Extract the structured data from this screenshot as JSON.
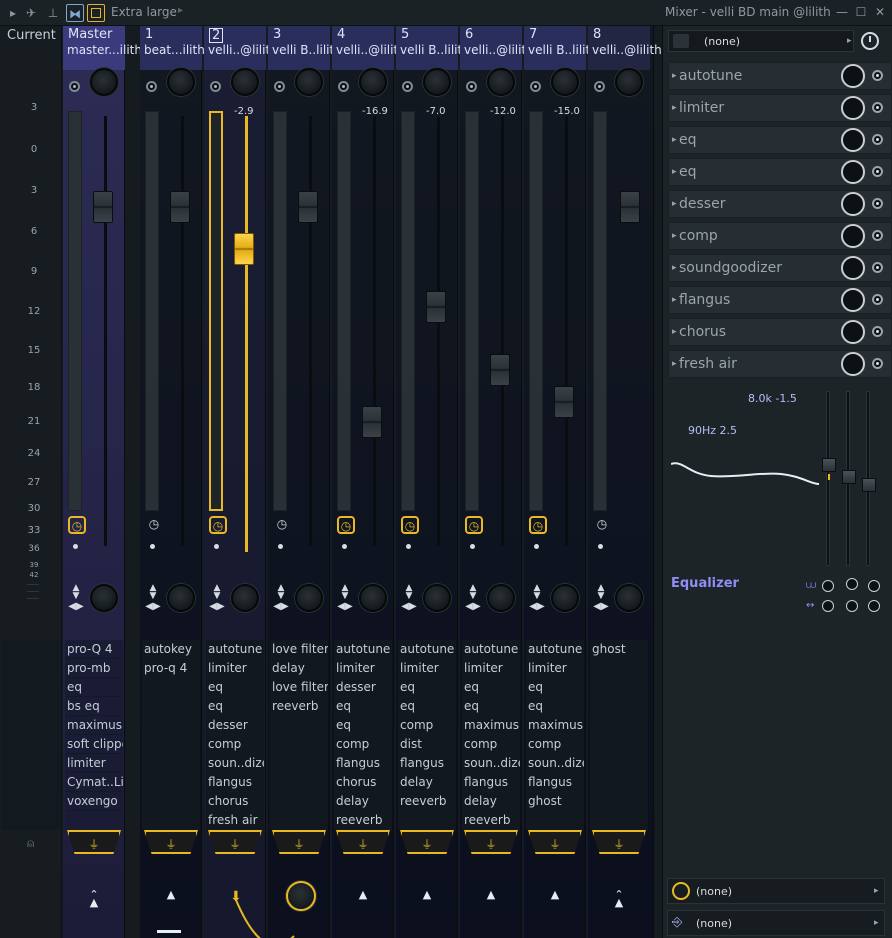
{
  "titlebar": {
    "size_label": "Extra large",
    "window_title": "Mixer - velli BD main @lilith",
    "icons": [
      "play-arrow-icon",
      "bird-icon",
      "pin-icon",
      "layout-icon",
      "panel-icon"
    ],
    "window_buttons": [
      "—",
      "☐",
      "✕"
    ]
  },
  "scale": {
    "label": "Current",
    "ticks": [
      "3",
      "0",
      "3",
      "6",
      "9",
      "12",
      "15",
      "18",
      "21",
      "24",
      "27",
      "30",
      "33",
      "36",
      "39",
      "42"
    ]
  },
  "strips": [
    {
      "num": "Master",
      "name": "master...ilith",
      "db": "",
      "slots": [
        "pro-Q 4",
        "pro-mb",
        "eq",
        "bs eq",
        "maximus",
        "soft clipper",
        "limiter",
        "Cymat..Lite",
        "voxengo"
      ],
      "selected": false,
      "clock_lit": true
    },
    {
      "num": "1",
      "name": "beat...ilith",
      "db": "",
      "slots": [
        "autokey",
        "pro-q 4"
      ],
      "selected": false,
      "clock_lit": false
    },
    {
      "num": "2",
      "name": "velli..@lilith",
      "db": "-2.9",
      "slots": [
        "autotune",
        "limiter",
        "eq",
        "eq",
        "desser",
        "comp",
        "soun..dizer",
        "flangus",
        "chorus",
        "fresh air"
      ],
      "selected": true,
      "clock_lit": true
    },
    {
      "num": "3",
      "name": "velli B..lilith",
      "db": "",
      "slots": [
        "love filter",
        "delay",
        "love filter",
        "reeverb"
      ],
      "selected": false,
      "clock_lit": false
    },
    {
      "num": "4",
      "name": "velli..@lilith",
      "db": "-16.9",
      "slots": [
        "autotune",
        "limiter",
        "desser",
        "eq",
        "eq",
        "comp",
        "flangus",
        "chorus",
        "delay",
        "reeverb"
      ],
      "selected": false,
      "clock_lit": true
    },
    {
      "num": "5",
      "name": "velli B..lilith",
      "db": "-7.0",
      "slots": [
        "autotune",
        "limiter",
        "eq",
        "eq",
        "comp",
        "dist",
        "flangus",
        "delay",
        "reeverb"
      ],
      "selected": false,
      "clock_lit": true
    },
    {
      "num": "6",
      "name": "velli..@lilith",
      "db": "-12.0",
      "slots": [
        "autotune",
        "limiter",
        "eq",
        "eq",
        "maximus",
        "comp",
        "soun..dizer",
        "flangus",
        "delay",
        "reeverb"
      ],
      "selected": false,
      "clock_lit": true
    },
    {
      "num": "7",
      "name": "velli B..lilith",
      "db": "-15.0",
      "slots": [
        "autotune",
        "limiter",
        "eq",
        "eq",
        "maximus",
        "comp",
        "soun..dizer",
        "flangus",
        "ghost"
      ],
      "selected": false,
      "clock_lit": true
    },
    {
      "num": "8",
      "name": "velli..@lilith",
      "db": "",
      "slots": [
        "ghost"
      ],
      "selected": false,
      "clock_lit": false
    }
  ],
  "panel": {
    "top_select": "(none)",
    "effects": [
      "autotune",
      "limiter",
      "eq",
      "eq",
      "desser",
      "comp",
      "soundgoodizer",
      "flangus",
      "chorus",
      "fresh air"
    ],
    "eq_readout_1": "8.0k -1.5",
    "eq_readout_2": "90Hz 2.5",
    "eq_name": "Equalizer",
    "bottom_select_1": "(none)",
    "bottom_select_2": "(none)"
  },
  "colors": {
    "accent": "#e8b923",
    "master_header": "#3b3a7c",
    "strip_header": "#2a2e5d",
    "eq_label": "#8f8ef5"
  }
}
